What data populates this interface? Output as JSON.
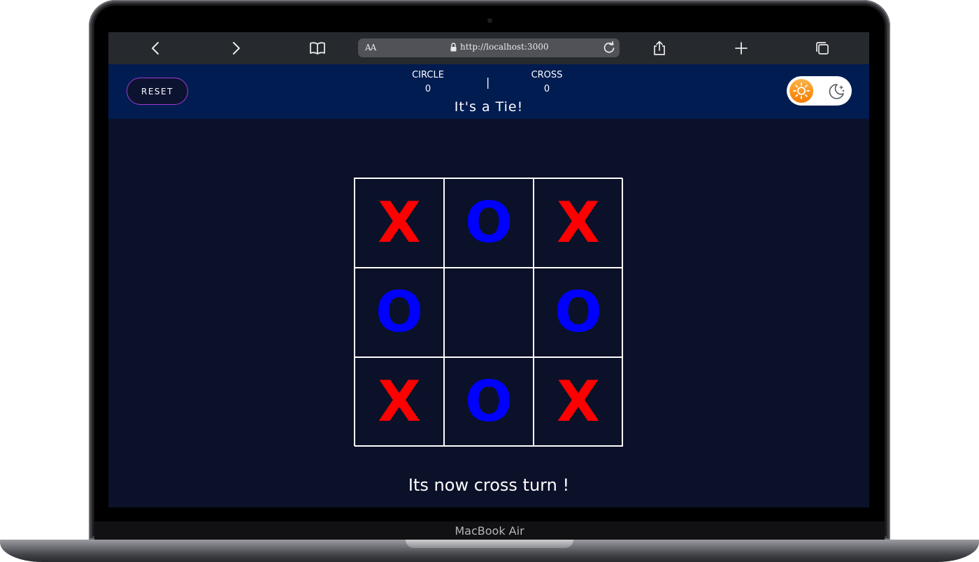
{
  "device": {
    "label": "MacBook Air"
  },
  "browser": {
    "url": "http://localhost:3000",
    "reader_label": "AA",
    "icons": [
      "back-icon",
      "forward-icon",
      "bookmarks-icon",
      "lock-icon",
      "reload-icon",
      "share-icon",
      "new-tab-icon",
      "tabs-icon"
    ]
  },
  "header": {
    "reset_label": "RESET",
    "circle": {
      "label": "CIRCLE",
      "score": "0"
    },
    "divider": "|",
    "cross": {
      "label": "CROSS",
      "score": "0"
    },
    "result": "It's a Tie!",
    "theme_toggle": {
      "light_icon": "sun-icon",
      "dark_icon": "moon-icon",
      "active": "light"
    }
  },
  "board": {
    "cells": [
      "X",
      "O",
      "X",
      "O",
      "",
      "O",
      "X",
      "O",
      "X"
    ]
  },
  "status": {
    "turn_text": "Its now cross turn !"
  },
  "colors": {
    "background": "#0b1128",
    "header": "#001c51",
    "cross": "#ff0000",
    "circle": "#0000ff",
    "grid": "#ffffff",
    "reset_border": "#a23bd1"
  }
}
